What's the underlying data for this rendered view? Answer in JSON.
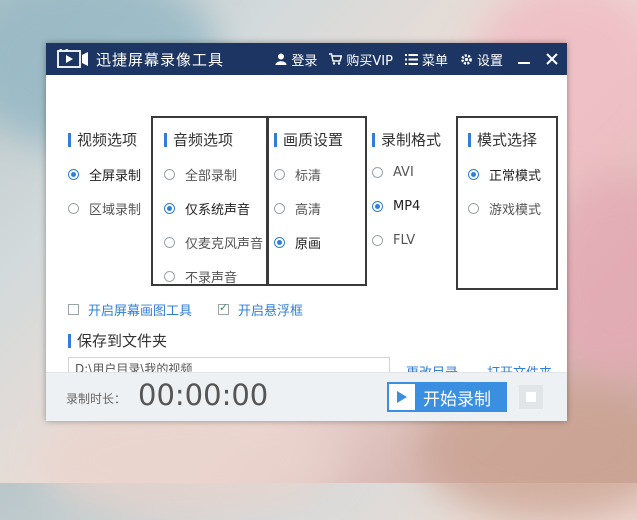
{
  "app": {
    "title": "迅捷屏幕录像工具",
    "login": "登录",
    "buy_vip": "购买VIP",
    "menu": "菜单",
    "settings": "设置"
  },
  "video_options": {
    "title": "视频选项",
    "items": [
      {
        "label": "全屏录制",
        "selected": true
      },
      {
        "label": "区域录制",
        "selected": false
      }
    ]
  },
  "audio_options": {
    "title": "音频选项",
    "items": [
      {
        "label": "全部录制",
        "selected": false
      },
      {
        "label": "仅系统声音",
        "selected": true
      },
      {
        "label": "仅麦克风声音",
        "selected": false
      },
      {
        "label": "不录声音",
        "selected": false
      }
    ]
  },
  "quality_settings": {
    "title": "画质设置",
    "items": [
      {
        "label": "标清",
        "selected": false
      },
      {
        "label": "高清",
        "selected": false
      },
      {
        "label": "原画",
        "selected": true
      }
    ]
  },
  "format": {
    "title": "录制格式",
    "items": [
      {
        "label": "AVI",
        "selected": false
      },
      {
        "label": "MP4",
        "selected": true
      },
      {
        "label": "FLV",
        "selected": false
      }
    ]
  },
  "mode": {
    "title": "模式选择",
    "items": [
      {
        "label": "正常模式",
        "selected": true
      },
      {
        "label": "游戏模式",
        "selected": false
      }
    ]
  },
  "checkboxes": {
    "drawing_tool": {
      "label": "开启屏幕画图工具",
      "checked": false
    },
    "floating_window": {
      "label": "开启悬浮框",
      "checked": true
    }
  },
  "save": {
    "title": "保存到文件夹",
    "path": "D:\\用户目录\\我的视频",
    "change_dir": "更改目录",
    "open_folder": "打开文件夹"
  },
  "footer": {
    "duration_label": "录制时长：",
    "duration": "00:00:00",
    "start_label": "开始录制"
  },
  "colors": {
    "titlebar": "#1c3563",
    "accent": "#2f7fd6",
    "start_button": "#3a8fe0"
  }
}
